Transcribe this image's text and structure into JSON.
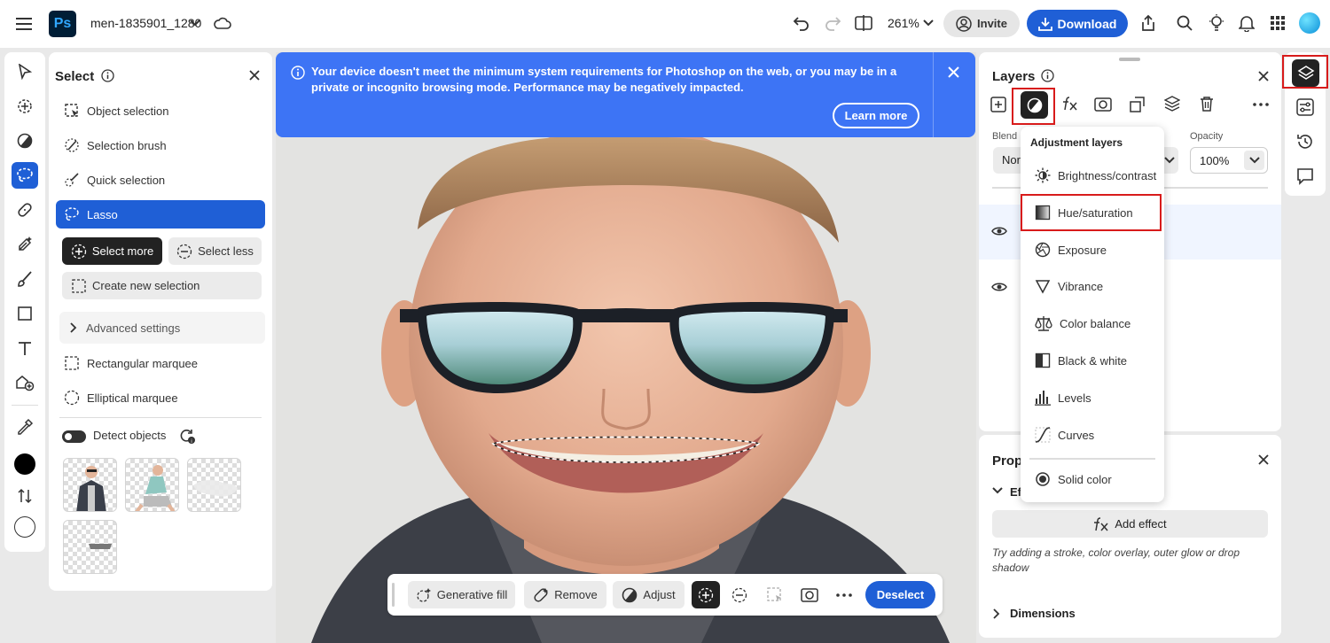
{
  "app": {
    "logo_text": "Ps",
    "document_name": "men-1835901_1280",
    "zoom_level": "261%",
    "invite_label": "Invite",
    "download_label": "Download",
    "accent_color": "#1f5fd6"
  },
  "select_panel": {
    "title": "Select",
    "tools": [
      {
        "label": "Object selection",
        "icon": "object-selection-icon"
      },
      {
        "label": "Selection brush",
        "icon": "selection-brush-icon"
      },
      {
        "label": "Quick selection",
        "icon": "quick-selection-icon"
      },
      {
        "label": "Lasso",
        "icon": "lasso-icon",
        "active": true
      }
    ],
    "select_more_label": "Select more",
    "select_less_label": "Select less",
    "create_new_label": "Create new selection",
    "advanced_settings_label": "Advanced settings",
    "marquee_tools": [
      {
        "label": "Rectangular marquee"
      },
      {
        "label": "Elliptical marquee"
      }
    ],
    "detect_objects_label": "Detect objects"
  },
  "banner": {
    "message": "Your device doesn't meet the minimum system requirements for Photoshop on the web, or you may be in a private or incognito browsing mode. Performance may be negatively impacted.",
    "learn_more_label": "Learn more"
  },
  "context_bar": {
    "generative_fill_label": "Generative fill",
    "remove_label": "Remove",
    "adjust_label": "Adjust",
    "deselect_label": "Deselect"
  },
  "layers_panel": {
    "title": "Layers",
    "blend_label": "Blend",
    "blend_value": "Nor",
    "opacity_label": "Opacity",
    "opacity_value": "100%"
  },
  "adjustment_menu": {
    "header": "Adjustment layers",
    "items": [
      {
        "label": "Brightness/contrast",
        "icon": "brightness-icon"
      },
      {
        "label": "Hue/saturation",
        "icon": "hue-saturation-icon",
        "highlighted": true
      },
      {
        "label": "Exposure",
        "icon": "exposure-icon"
      },
      {
        "label": "Vibrance",
        "icon": "vibrance-icon"
      },
      {
        "label": "Color balance",
        "icon": "color-balance-icon"
      },
      {
        "label": "Black & white",
        "icon": "black-white-icon"
      },
      {
        "label": "Levels",
        "icon": "levels-icon"
      },
      {
        "label": "Curves",
        "icon": "curves-icon"
      },
      {
        "label": "Solid color",
        "icon": "solid-color-icon"
      }
    ]
  },
  "properties_panel": {
    "title": "Prop",
    "effects_label": "Ef",
    "add_effect_label": "Add effect",
    "hint": "Try adding a stroke, color overlay, outer glow or drop shadow",
    "dimensions_label": "Dimensions"
  }
}
